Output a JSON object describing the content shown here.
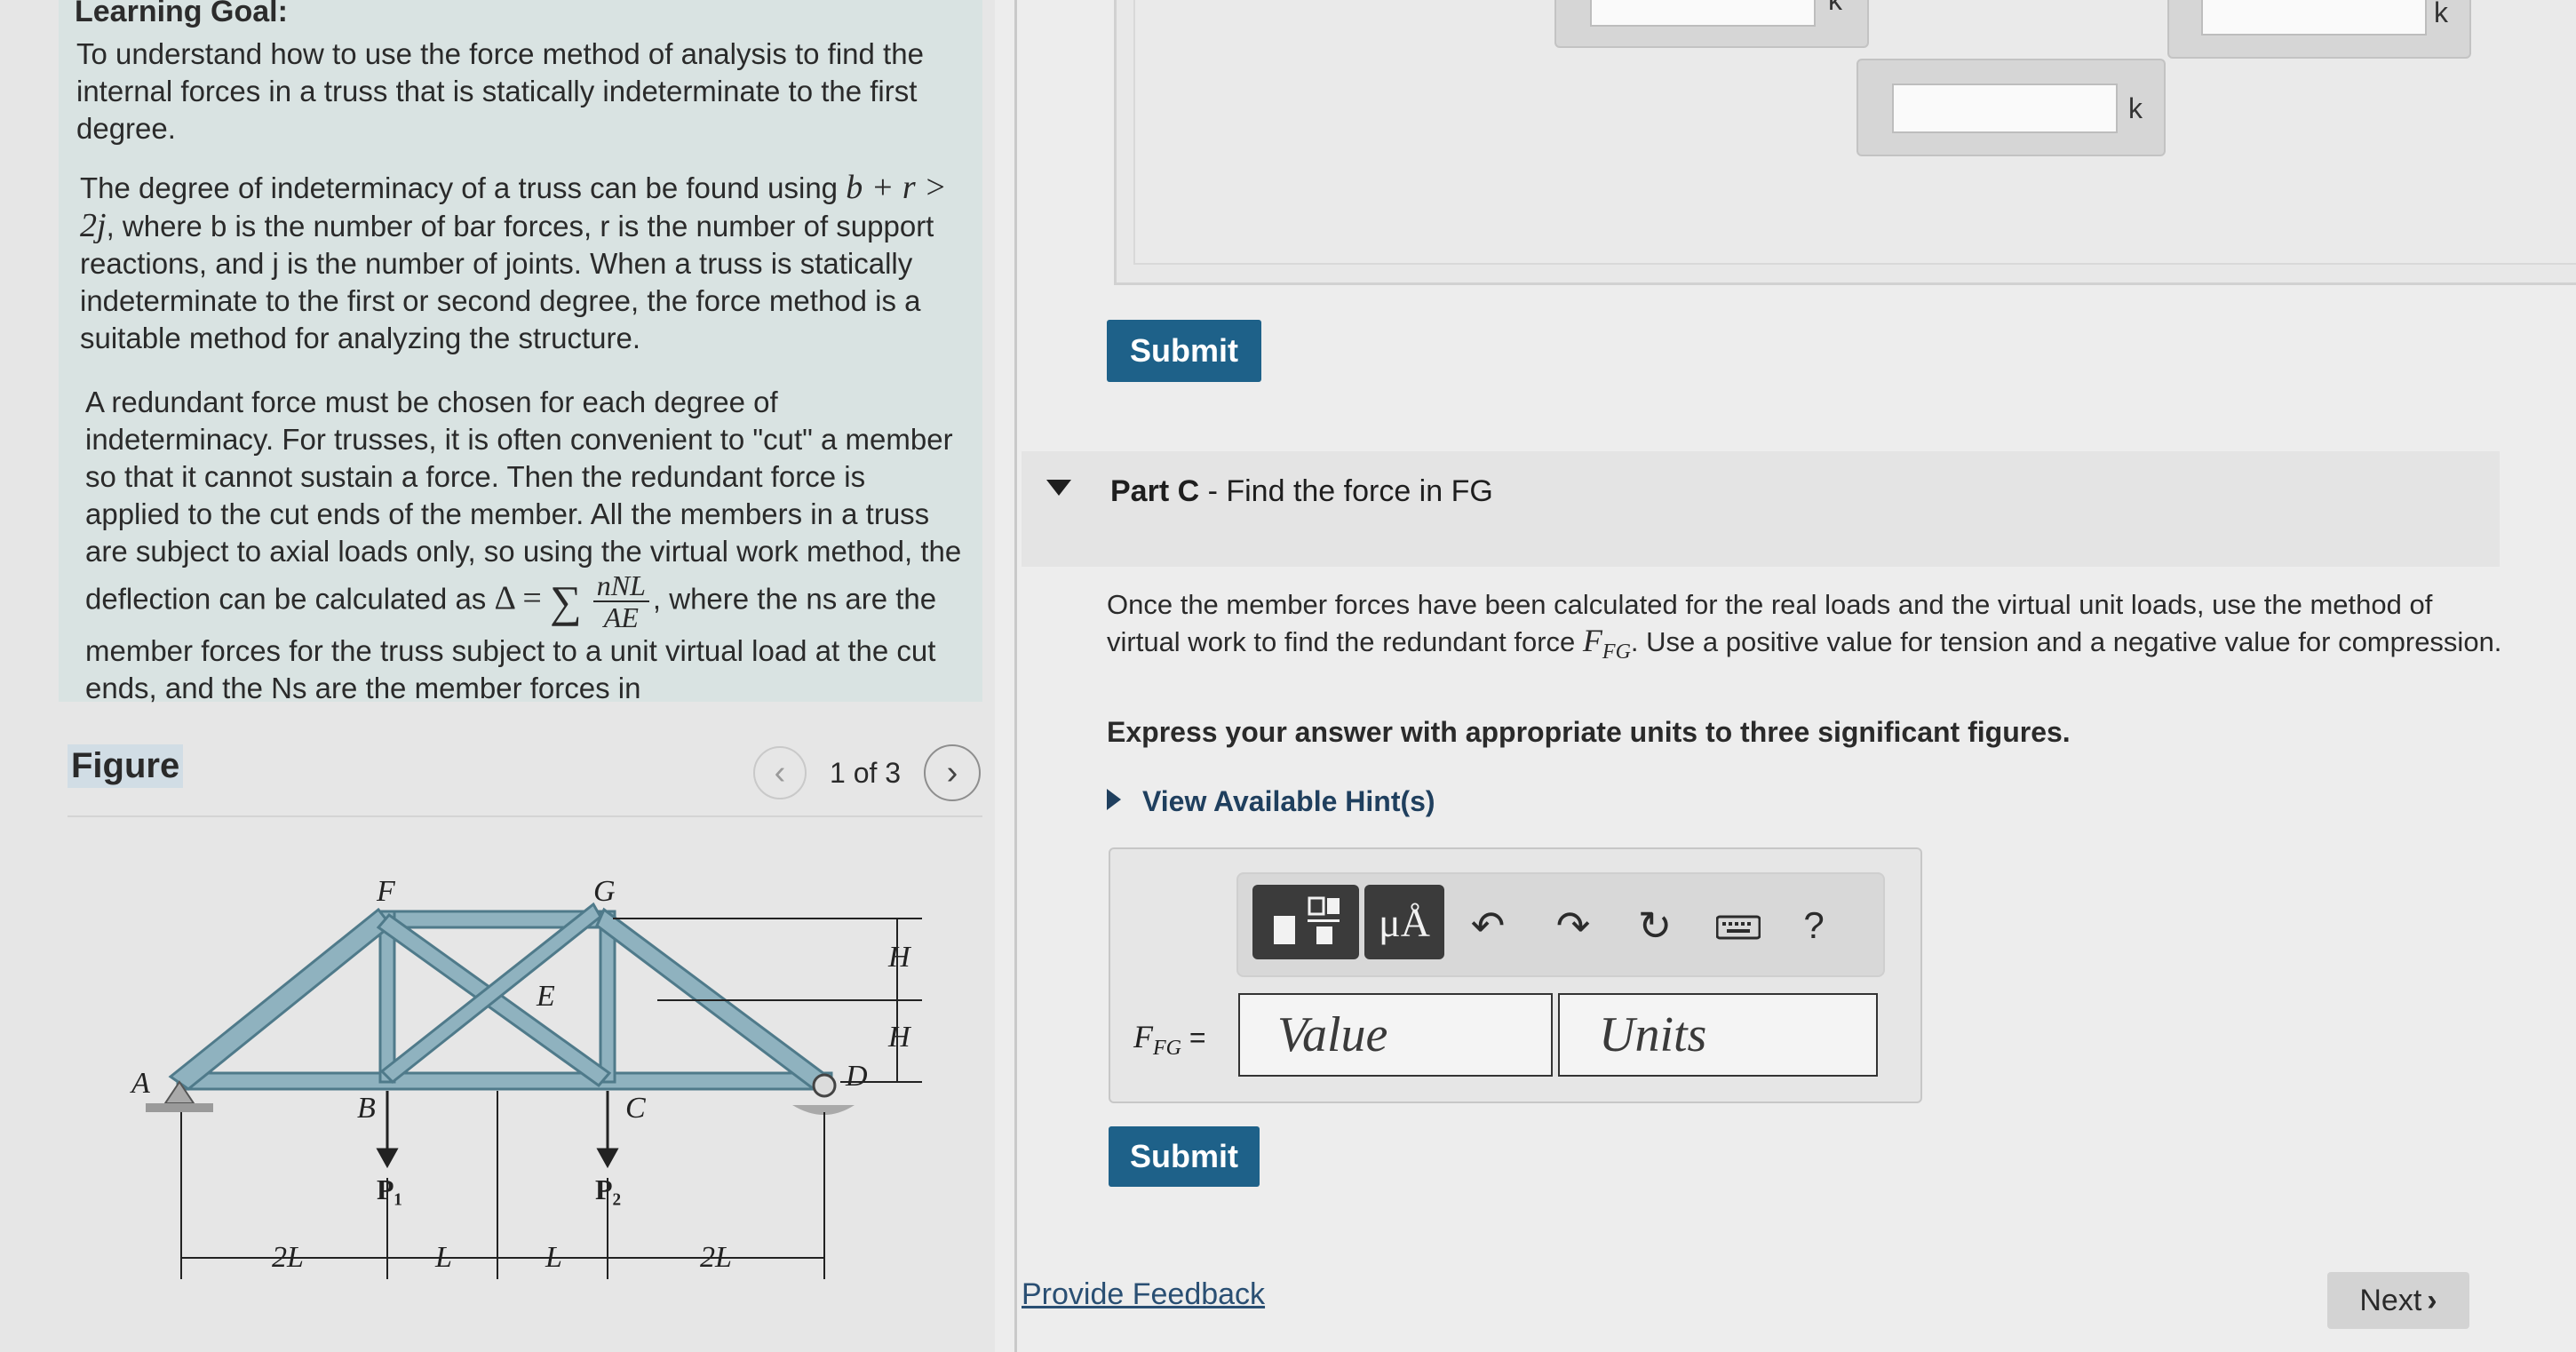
{
  "learning_goal": {
    "title": "Learning Goal:",
    "intro": "To understand how to use the force method of analysis to find the internal forces in a truss that is statically indeterminate to the first degree.",
    "p2_a": "The degree of indeterminacy of a truss can be found using",
    "p2_formula": "b + r > 2j",
    "p2_b": ", where b is the number of bar forces, r is the number of support reactions, and j is the number of joints. When a truss is statically indeterminate to the first or second degree, the force method is a suitable method for analyzing the structure.",
    "p3_a": "A redundant force must be chosen for each degree of indeterminacy. For trusses, it is often convenient to \"cut\" a member so that it cannot sustain a force. Then the redundant force is applied to the cut ends of the member. All the members in a truss are subject to axial loads only, so using the virtual work method, the deflection can be calculated as",
    "p3_formula_lhs": "Δ =",
    "p3_formula_sum": "∑",
    "p3_formula_num": "nNL",
    "p3_formula_den": "AE",
    "p3_b": "where the ns are the member forces for the truss subject to a unit virtual load at the cut ends, and the Ns are the member forces in"
  },
  "figure": {
    "label": "Figure",
    "counter": "1 of 3",
    "prev_icon": "chevron-left-icon",
    "next_icon": "chevron-right-icon",
    "labels": {
      "A": "A",
      "B": "B",
      "C": "C",
      "D": "D",
      "E": "E",
      "F": "F",
      "G": "G",
      "H1": "H",
      "H2": "H",
      "P1": "P₁",
      "P2": "P₂",
      "dim1": "2L",
      "dim2": "L",
      "dim3": "L",
      "dim4": "2L"
    }
  },
  "partb": {
    "unit_1": "k",
    "unit_2": "k",
    "unit_3": "k",
    "submit_label": "Submit"
  },
  "partc": {
    "title_bold": "Part C",
    "title_rest": " - Find the force in FG",
    "question_a": "Once the member forces have been calculated for the real loads and the virtual unit loads, use the method of virtual work to find the redundant force",
    "question_var": "F",
    "question_sub": "FG",
    "question_b": ". Use a positive value for tension and a negative value for compression.",
    "express": "Express your answer with appropriate units to three significant figures.",
    "hint": "View Available Hint(s)",
    "var_label": "F",
    "var_sub": "FG",
    "var_eq": " =",
    "value_placeholder": "Value",
    "units_placeholder": "Units",
    "submit_label": "Submit",
    "toolbar": {
      "units_label": "μÅ",
      "help_label": "?"
    }
  },
  "footer": {
    "feedback": "Provide Feedback",
    "next": "Next"
  },
  "colors": {
    "truss_member": "#7fa7b5",
    "truss_stroke": "#4f7a8a",
    "submit": "#1e6189"
  }
}
